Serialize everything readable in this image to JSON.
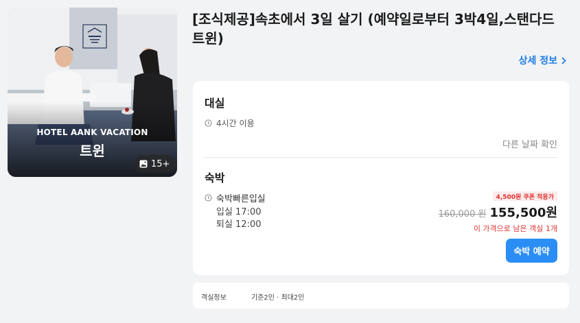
{
  "photo": {
    "hotel_name": "HOTEL AANK VACATION",
    "room_name": "트윈",
    "photo_count": "15+",
    "logo_icon": "hotel-logo-icon",
    "gallery_icon": "image-icon"
  },
  "title": "[조식제공]속초에서 3일 살기 (예약일로부터 3박4일,스탠다드 트윈)",
  "detail_link": {
    "label": "상세 정보",
    "icon": "chevron-right-icon",
    "color": "#1e7de8"
  },
  "day_use": {
    "title": "대실",
    "duration": "4시간 이용",
    "other_dates": "다른 날짜 확인",
    "icon": "clock-icon"
  },
  "stay": {
    "title": "숙박",
    "type": "숙박빠른입실",
    "checkin": "입실 17:00",
    "checkout": "퇴실 12:00",
    "coupon": "4,500원 쿠폰 적용가",
    "old_price": "160,000 원",
    "new_price": "155,500원",
    "remaining": "이 가격으로 남은 객실 1개",
    "book_label": "숙박 예약",
    "icon": "clock-icon",
    "accent_color": "#2b8ef5",
    "alert_color": "#e0312f"
  },
  "room_info": {
    "label": "객실정보",
    "value": "기준2인 · 최대2인"
  }
}
